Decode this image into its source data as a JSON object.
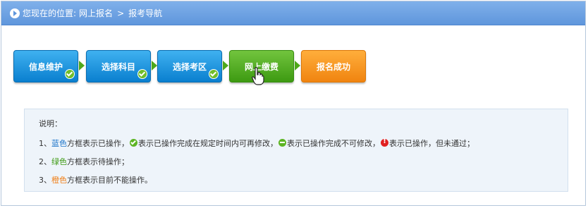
{
  "breadcrumb": {
    "prefix": "您现在的位置:",
    "item1": "网上报名",
    "separator": ">",
    "item2": "报考导航"
  },
  "steps": [
    {
      "label": "信息维护",
      "status": "blue",
      "checked": true
    },
    {
      "label": "选择科目",
      "status": "blue",
      "checked": true
    },
    {
      "label": "选择考区",
      "status": "blue",
      "checked": true
    },
    {
      "label": "网上缴费",
      "status": "green",
      "checked": false
    },
    {
      "label": "报名成功",
      "status": "orange",
      "checked": false
    }
  ],
  "notes": {
    "title": "说明：",
    "line1": {
      "num": "1、",
      "color_word": "蓝色",
      "text_a": "方框表示已操作，",
      "text_b": "表示已操作完成在规定时间内可再修改，",
      "text_c": "表示已操作完成不可修改，",
      "text_d": "表示已操作，但未通过；"
    },
    "line2": {
      "num": "2、",
      "color_word": "绿色",
      "text": "方框表示待操作；"
    },
    "line3": {
      "num": "3、",
      "color_word": "橙色",
      "text": "方框表示目前不能操作。"
    }
  },
  "colors": {
    "header": "#6aa0e2",
    "blue": "#1a8be0",
    "green": "#4ea81a",
    "orange": "#f59424"
  }
}
